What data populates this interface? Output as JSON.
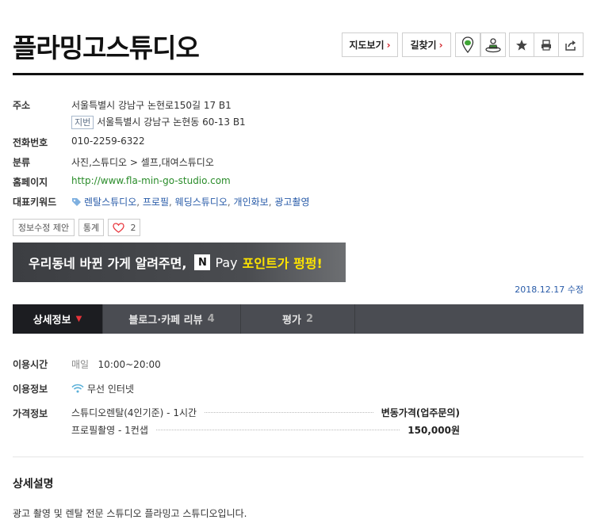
{
  "place": {
    "name": "플라밍고스튜디오"
  },
  "toolbar": {
    "map_label": "지도보기",
    "route_label": "길찾기",
    "arrow": "›",
    "icons": [
      "location-pin-icon",
      "street-view-icon",
      "star-icon",
      "print-icon",
      "share-icon"
    ]
  },
  "info": {
    "address_label": "주소",
    "address": "서울특별시 강남구 논현로150길 17 B1",
    "jibun_tag": "지번",
    "jibun_address": "서울특별시 강남구 논현동 60-13 B1",
    "phone_label": "전화번호",
    "phone": "010-2259-6322",
    "category_label": "분류",
    "category": "사진,스튜디오 > 셀프,대여스튜디오",
    "homepage_label": "홈페이지",
    "homepage": "http://www.fla-min-go-studio.com",
    "keywords_label": "대표키워드",
    "keywords": [
      "렌탈스튜디오",
      "프로필",
      "웨딩스튜디오",
      "개인화보",
      "광고촬영"
    ]
  },
  "actions": {
    "suggest_edit": "정보수정 제안",
    "stats": "통계",
    "like_count": "2"
  },
  "banner": {
    "text": "우리동네 바뀐 가게 알려주면,",
    "npay_n": "N",
    "npay_pay": "Pay",
    "highlight": "포인트가 펑펑!"
  },
  "updated": "2018.12.17 수정",
  "tabs": [
    {
      "label": "상세정보",
      "count": ""
    },
    {
      "label": "블로그·카페 리뷰",
      "count": "4"
    },
    {
      "label": "평가",
      "count": "2"
    }
  ],
  "details": {
    "hours_label": "이용시간",
    "hours_day": "매일",
    "hours_time": "10:00~20:00",
    "amenities_label": "이용정보",
    "amenity": "무선 인터넷",
    "price_label": "가격정보",
    "prices": [
      {
        "item": "스튜디오렌탈(4인기준) - 1시간",
        "price": "변동가격(업주문의)"
      },
      {
        "item": "프로필촬영 - 1컨샙",
        "price": "150,000원"
      }
    ]
  },
  "description": {
    "title": "상세설명",
    "text": "광고 촬영 및 렌탈 전문 스튜디오 플라밍고 스튜디오입니다."
  },
  "colors": {
    "accent_red": "#d2232a",
    "link_blue": "#285ba8",
    "link_green": "#2a8c2a",
    "tab_bg": "#4a4c52",
    "tab_active": "#1c1d21"
  }
}
